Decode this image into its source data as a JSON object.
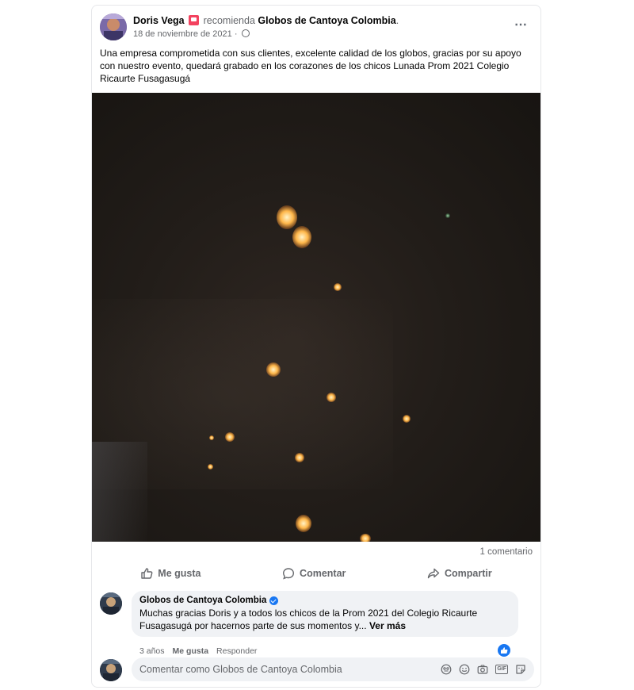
{
  "post": {
    "author": "Doris Vega",
    "verb": "recomienda",
    "page_name": "Globos de Cantoya Colombia",
    "page_suffix": ".",
    "date": "18 de noviembre de 2021 ·",
    "text": "Una empresa comprometida con sus clientes, excelente calidad de los globos, gracias por su apoyo con nuestro evento, quedará grabado en los corazones de los chicos Lunada Prom 2021 Colegio Ricaurte Fusagasugá",
    "more_icon": "⋯"
  },
  "stats": {
    "comments": "1 comentario"
  },
  "actions": {
    "like": "Me gusta",
    "comment": "Comentar",
    "share": "Compartir"
  },
  "comment": {
    "author": "Globos de Cantoya Colombia",
    "text": "Muchas gracias Doris y a todos los chicos de la Prom 2021 del Colegio Ricaurte Fusagasugá por hacernos parte de sus momentos y...",
    "see_more": "Ver más",
    "age": "3 años",
    "like": "Me gusta",
    "reply": "Responder"
  },
  "composer": {
    "placeholder": "Comentar como Globos de Cantoya Colombia",
    "gif_label": "GIF"
  },
  "colors": {
    "accent": "#1877f2",
    "muted": "#65676b",
    "recommend": "#f3425f"
  },
  "icons": [
    "recommend-icon",
    "globe-icon",
    "more-icon",
    "like-icon",
    "comment-icon",
    "share-icon",
    "verified-icon",
    "like-reaction-icon",
    "sticker-icon",
    "emoji-icon",
    "camera-icon",
    "gif-icon",
    "avatar-sticker-icon"
  ]
}
